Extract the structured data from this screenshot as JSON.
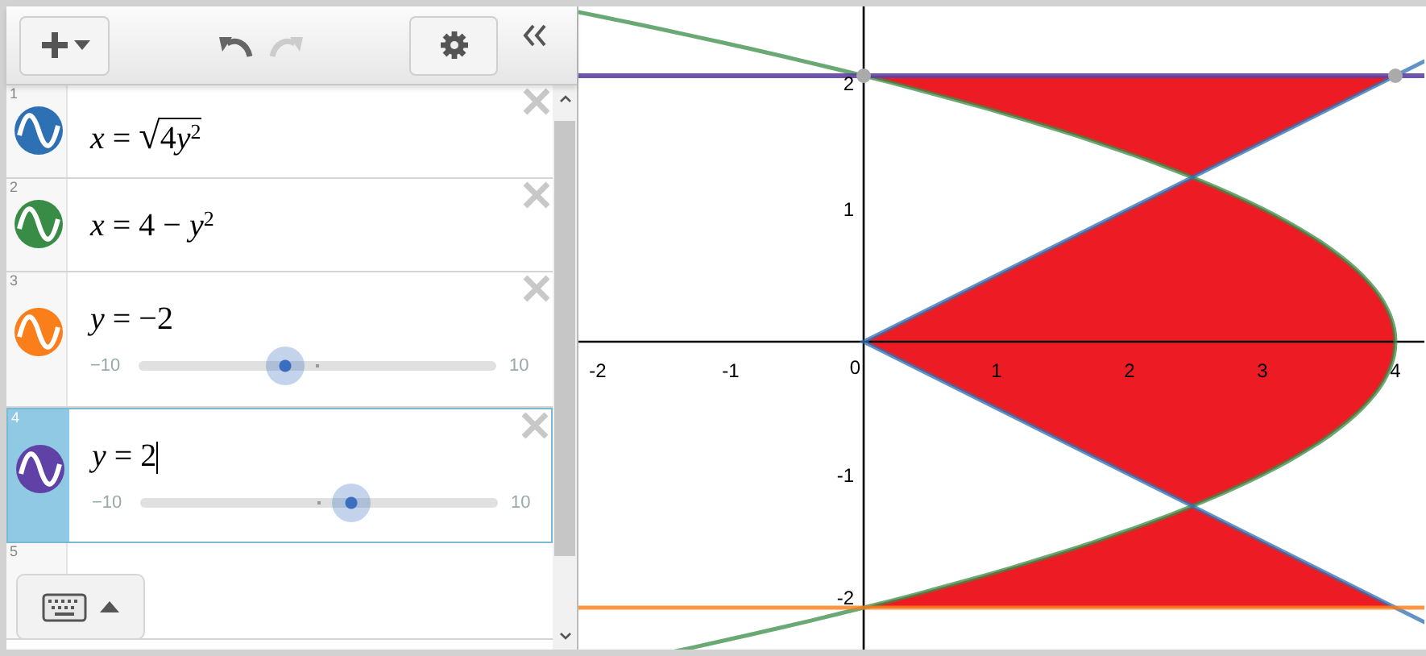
{
  "toolbar": {
    "undo_disabled": false,
    "redo_disabled": true
  },
  "expressions": [
    {
      "number": "1",
      "color": "#2d70b3",
      "kind": "plain",
      "selected": false,
      "cursor": false,
      "math": "*x* = ",
      "radical_sign": "√",
      "radicand": [
        "4",
        "*y*$^{2}$"
      ]
    },
    {
      "number": "2",
      "color": "#388c46",
      "kind": "plain",
      "selected": false,
      "cursor": false,
      "math": "*x* = 4 − *y*$^{2}$"
    },
    {
      "number": "3",
      "color": "#fa7e19",
      "kind": "slider",
      "selected": false,
      "cursor": false,
      "math": "*y* = −2",
      "slider": {
        "min": "−10",
        "max": "10",
        "level": 0.4
      }
    },
    {
      "number": "4",
      "color": "#6042a6",
      "kind": "slider",
      "selected": true,
      "cursor": true,
      "math": "*y* = 2",
      "slider": {
        "min": "−10",
        "max": "10",
        "level": 0.6
      }
    },
    {
      "number": "5",
      "kind": "empty",
      "selected": false
    }
  ],
  "graph": {
    "x_labels": [
      "-2",
      "-1",
      "0",
      "1",
      "2",
      "3",
      "4"
    ],
    "y_labels": [
      "2",
      "1",
      "-1",
      "-2"
    ]
  }
}
